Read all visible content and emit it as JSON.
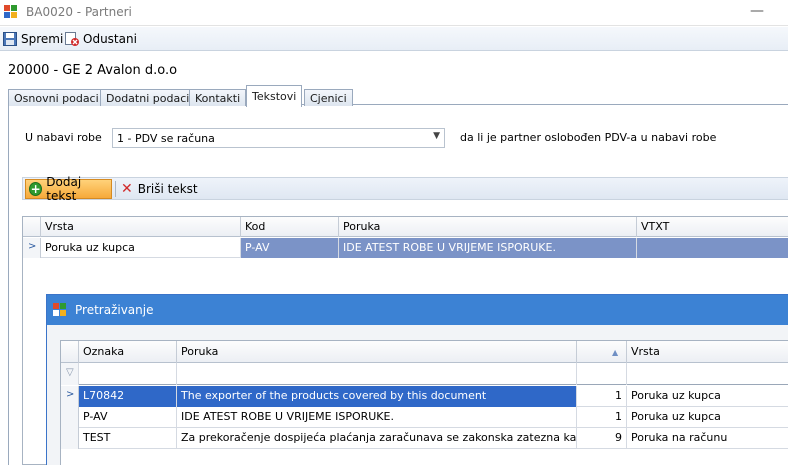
{
  "window": {
    "title": "BA0020 - Partneri",
    "minimize_glyph": "—"
  },
  "toolbar": {
    "save_label": "Spremi",
    "cancel_label": "Odustani"
  },
  "partner": {
    "title": "20000 - GE 2 Avalon d.o.o"
  },
  "tabs": [
    {
      "label": "Osnovni podaci"
    },
    {
      "label": "Dodatni podaci"
    },
    {
      "label": "Kontakti"
    },
    {
      "label": "Tekstovi"
    },
    {
      "label": "Cjenici"
    }
  ],
  "active_tab": "Tekstovi",
  "nabava": {
    "label": "U nabavi robe",
    "selected": "1 - PDV se računa",
    "hint": "da li je partner oslobođen PDV-a u nabavi robe"
  },
  "text_toolbar": {
    "add_label": "Dodaj tekst",
    "delete_label": "Briši tekst"
  },
  "texts_grid": {
    "columns": [
      "Vrsta",
      "Kod",
      "Poruka",
      "VTXT"
    ],
    "rows": [
      {
        "vrsta": "Poruka uz kupca",
        "kod": "P-AV",
        "poruka": "IDE ATEST ROBE U VRIJEME ISPORUKE.",
        "vtxt": ""
      }
    ]
  },
  "search_dialog": {
    "title": "Pretraživanje",
    "columns": [
      "Oznaka",
      "Poruka",
      "",
      "Vrsta"
    ],
    "rows": [
      {
        "oznaka": "L70842",
        "poruka": "The exporter of the products covered by this document",
        "n": "1",
        "vrsta": "Poruka uz kupca"
      },
      {
        "oznaka": "P-AV",
        "poruka": "IDE ATEST ROBE U VRIJEME ISPORUKE.",
        "n": "1",
        "vrsta": "Poruka uz kupca"
      },
      {
        "oznaka": "TEST",
        "poruka": "Za prekoračenje dospijeća plaćanja zaračunava se zakonska zatezna kamata.",
        "n": "9",
        "vrsta": "Poruka na računu"
      }
    ]
  },
  "colors": {
    "accent": "#3c82d4",
    "selection": "#2f68c8",
    "selection_soft": "#7b93c7",
    "add_button": "#f6a93a"
  }
}
